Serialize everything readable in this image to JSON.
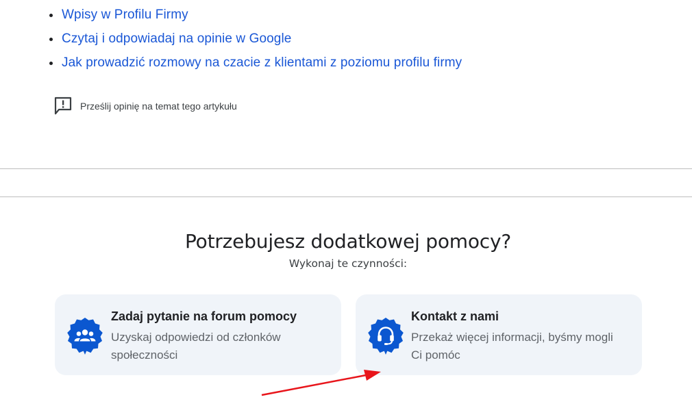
{
  "related_links": [
    {
      "label": "Wpisy w Profilu Firmy"
    },
    {
      "label": "Czytaj i odpowiadaj na opinie w Google"
    },
    {
      "label": "Jak prowadzić rozmowy na czacie z klientami z poziomu profilu firmy"
    }
  ],
  "feedback": {
    "icon": "feedback-icon",
    "label": "Prześlij opinię na temat tego artykułu"
  },
  "help_section": {
    "title": "Potrzebujesz dodatkowej pomocy?",
    "subtitle": "Wykonaj te czynności:",
    "cards": [
      {
        "icon": "community-icon",
        "title": "Zadaj pytanie na forum pomocy",
        "description_line1": "Uzyskaj odpowiedzi od członków",
        "description_line2": "społeczności"
      },
      {
        "icon": "headset-icon",
        "title": "Kontakt z nami",
        "description_line1": "Przekaż więcej informacji, byśmy mogli",
        "description_line2": "Ci pomóc"
      }
    ]
  },
  "colors": {
    "link": "#1a57d6",
    "card_background": "#f0f4f9",
    "icon_badge": "#0b57d0",
    "annotation_arrow": "#e8151b"
  }
}
